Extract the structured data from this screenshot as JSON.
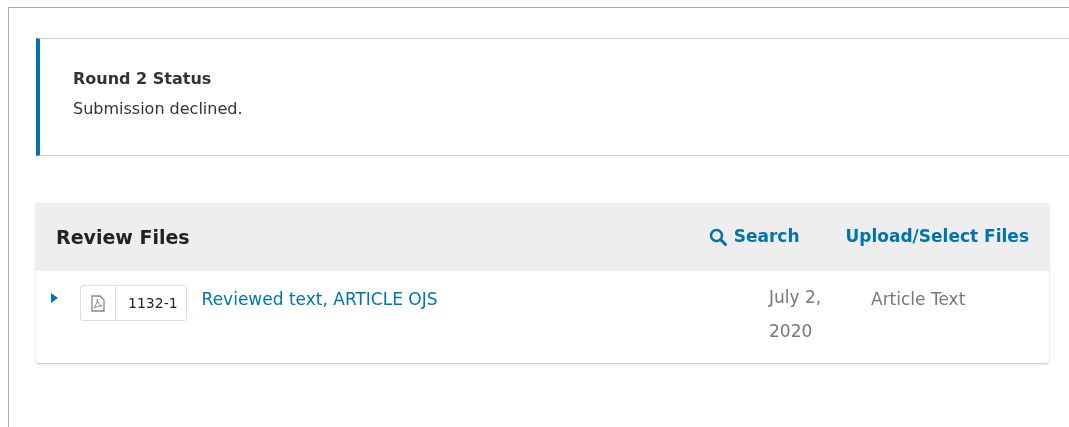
{
  "status_notice": {
    "title": "Round 2 Status",
    "message": "Submission declined."
  },
  "review_files": {
    "title": "Review Files",
    "actions": [
      {
        "kind": "search",
        "label": "Search"
      },
      {
        "kind": "upload",
        "label": "Upload/Select Files"
      }
    ],
    "rows": [
      {
        "expanded": false,
        "file_id": "1132-1",
        "name": "Reviewed text, ARTICLE OJS",
        "date": "July 2, 2020",
        "type": "Article Text"
      }
    ]
  }
}
